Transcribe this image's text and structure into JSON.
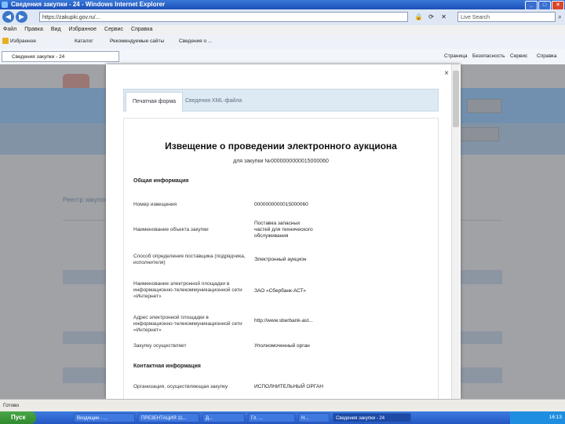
{
  "window": {
    "title": "Сведения закупки - 24 - Windows Internet Explorer",
    "controls": [
      "_",
      "□",
      "×"
    ]
  },
  "addressbar": {
    "url": "https://zakupki.gov.ru/...",
    "search_placeholder": "Live Search"
  },
  "menu": [
    "Файл",
    "Правка",
    "Вид",
    "Избранное",
    "Сервис",
    "Справка"
  ],
  "favorites": {
    "label": "Избранное",
    "items": [
      "Каталог",
      "Рекомендуемые сайты",
      "Сведения о ..."
    ]
  },
  "tab": {
    "label": "Сведения закупки - 24"
  },
  "commandbar": [
    "Страница",
    "Безопасность",
    "Сервис",
    "Справка"
  ],
  "modal": {
    "close": "×",
    "tabs": [
      "Печатная форма",
      "Сведения XML-файла"
    ],
    "doc": {
      "title": "Извещение о проведении электронного аукциона",
      "subtitle": "для закупки №0000000000015000060",
      "sections": [
        {
          "heading": "Общая информация",
          "rows": [
            {
              "label": "Номер извещения",
              "value": "0000000000015000060"
            },
            {
              "label": "Наименование объекта закупки",
              "value": "Поставка запасных частей для технического обслуживания"
            },
            {
              "label": "Способ определения поставщика (подрядчика, исполнителя)",
              "value": "Электронный аукцион"
            },
            {
              "label": "Наименование электронной площадки в информационно-телекоммуникационной сети «Интернет»",
              "value": "ЗАО «Сбербанк-АСТ»"
            },
            {
              "label": "Адрес электронной площадки в информационно-телекоммуникационной сети «Интернет»",
              "value": "http://www.sberbank-ast..."
            },
            {
              "label": "Закупку осуществляет",
              "value": "Уполномоченный орган"
            }
          ]
        },
        {
          "heading": "Контактная информация",
          "rows": [
            {
              "label": "Организация, осуществляющая закупку",
              "value": "ИСПОЛНИТЕЛЬНЫЙ ОРГАН"
            }
          ]
        }
      ]
    }
  },
  "background": {
    "registry_title": "Реестр закупок"
  },
  "statusbar": {
    "text": "Готово"
  },
  "taskbar": {
    "start": "Пуск",
    "items": [
      "Входящие - ...",
      "ПРЕЗЕНТАЦИЯ 11...",
      "Д...",
      "Гл. ...",
      "Н...",
      "Сведения закупки - 24"
    ],
    "clock": "16:13"
  }
}
